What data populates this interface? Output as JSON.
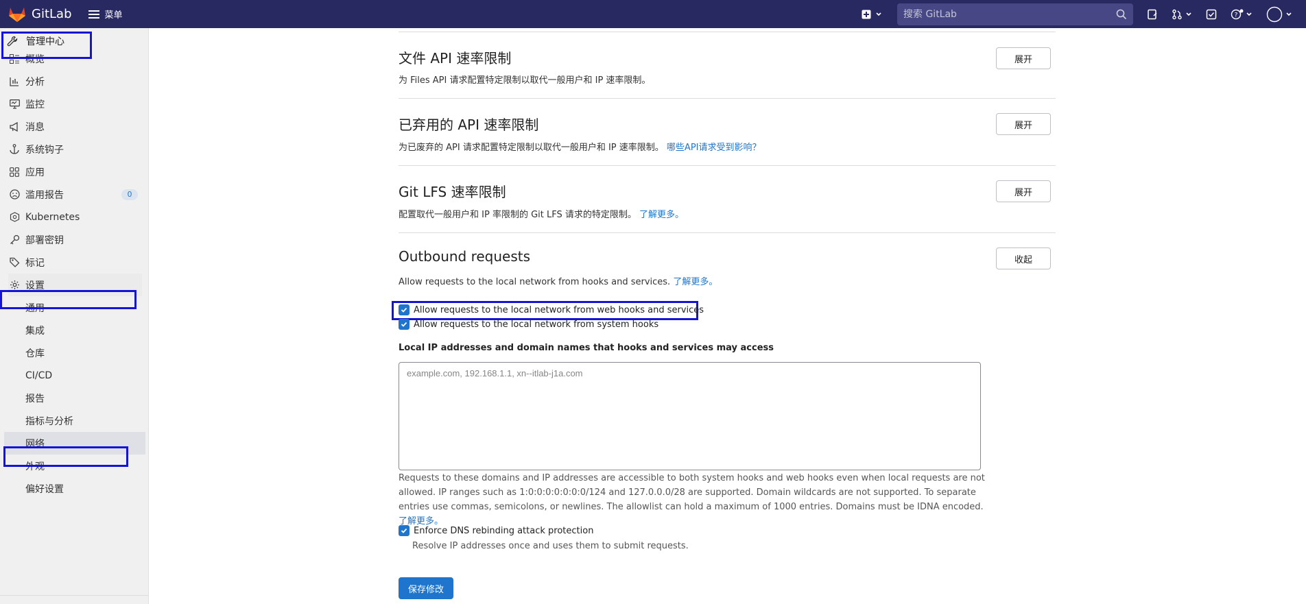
{
  "topbar": {
    "app_name": "GitLab",
    "menu_label": "菜单",
    "search_placeholder": "搜索 GitLab"
  },
  "sidebar": {
    "header": "管理中心",
    "items": [
      {
        "label": "概览",
        "icon": "overview-icon"
      },
      {
        "label": "分析",
        "icon": "analytics-icon"
      },
      {
        "label": "监控",
        "icon": "monitor-icon"
      },
      {
        "label": "消息",
        "icon": "messages-icon"
      },
      {
        "label": "系统钩子",
        "icon": "hook-icon"
      },
      {
        "label": "应用",
        "icon": "apps-icon"
      },
      {
        "label": "滥用报告",
        "icon": "abuse-icon",
        "badge": "0"
      },
      {
        "label": "Kubernetes",
        "icon": "kubernetes-icon"
      },
      {
        "label": "部署密钥",
        "icon": "key-icon"
      },
      {
        "label": "标记",
        "icon": "label-icon"
      },
      {
        "label": "设置",
        "icon": "settings-icon"
      }
    ],
    "settings_sub": [
      "通用",
      "集成",
      "仓库",
      "CI/CD",
      "报告",
      "指标与分析",
      "网络",
      "外观",
      "偏好设置"
    ]
  },
  "sections": {
    "files_api": {
      "title": "文件 API 速率限制",
      "desc": "为 Files API 请求配置特定限制以取代一般用户和 IP 速率限制。",
      "button": "展开"
    },
    "deprecated_api": {
      "title": "已弃用的 API 速率限制",
      "desc": "为已废弃的 API 请求配置特定限制以取代一般用户和 IP 速率限制。",
      "link": "哪些API请求受到影响？",
      "button": "展开"
    },
    "git_lfs": {
      "title": "Git LFS 速率限制",
      "desc": "配置取代一般用户和 IP 率限制的 Git LFS 请求的特定限制。",
      "link": "了解更多。",
      "button": "展开"
    },
    "outbound": {
      "title": "Outbound requests",
      "desc": "Allow requests to the local network from hooks and services.",
      "link": "了解更多。",
      "button": "收起",
      "cb_web_hooks": "Allow requests to the local network from web hooks and services",
      "cb_system_hooks": "Allow requests to the local network from system hooks",
      "allowlist_label": "Local IP addresses and domain names that hooks and services may access",
      "allowlist_placeholder": "example.com, 192.168.1.1, xn--itlab-j1a.com",
      "allowlist_value": "",
      "help_text": "Requests to these domains and IP addresses are accessible to both system hooks and web hooks even when local requests are not allowed. IP ranges such as 1:0:0:0:0:0:0:0/124 and 127.0.0.0/28 are supported. Domain wildcards are not supported. To separate entries use commas, semicolons, or newlines. The allowlist can hold a maximum of 1000 entries. Domains must be IDNA encoded.",
      "help_link": "了解更多。",
      "cb_dns": "Enforce DNS rebinding attack protection",
      "dns_desc": "Resolve IP addresses once and uses them to submit requests.",
      "save_button": "保存修改"
    }
  },
  "colors": {
    "topbar": "#292961",
    "primary": "#1f75cb",
    "highlight": "#1414d6"
  }
}
